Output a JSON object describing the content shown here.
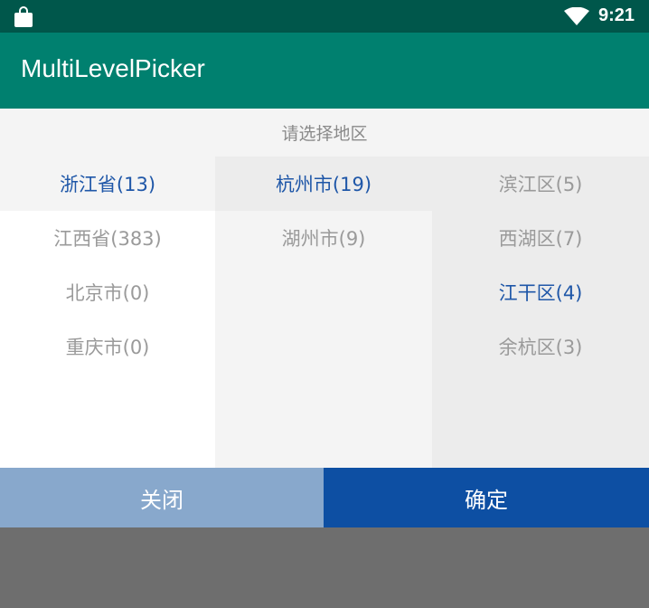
{
  "status_bar": {
    "time": "9:21"
  },
  "app_bar": {
    "title": "MultiLevelPicker"
  },
  "picker": {
    "header": "请选择地区",
    "provinces": [
      {
        "label": "浙江省(13)",
        "selected": true
      },
      {
        "label": "江西省(383)",
        "selected": false
      },
      {
        "label": "北京市(0)",
        "selected": false
      },
      {
        "label": "重庆市(0)",
        "selected": false
      }
    ],
    "cities": [
      {
        "label": "杭州市(19)",
        "selected": true
      },
      {
        "label": "湖州市(9)",
        "selected": false
      }
    ],
    "districts": [
      {
        "label": "滨江区(5)",
        "selected": false
      },
      {
        "label": "西湖区(7)",
        "selected": false
      },
      {
        "label": "江干区(4)",
        "selected": true
      },
      {
        "label": "余杭区(3)",
        "selected": false
      }
    ],
    "close_label": "关闭",
    "confirm_label": "确定"
  },
  "colors": {
    "status_bar": "#00574b",
    "app_bar": "#00806f",
    "selected_text": "#1f57a8",
    "close_button": "#88a8cc",
    "confirm_button": "#0d4fa3",
    "scrim": "#6e6e6e"
  },
  "icons": {
    "status_left": "shopping-bag-icon",
    "status_right": "wifi-icon"
  }
}
